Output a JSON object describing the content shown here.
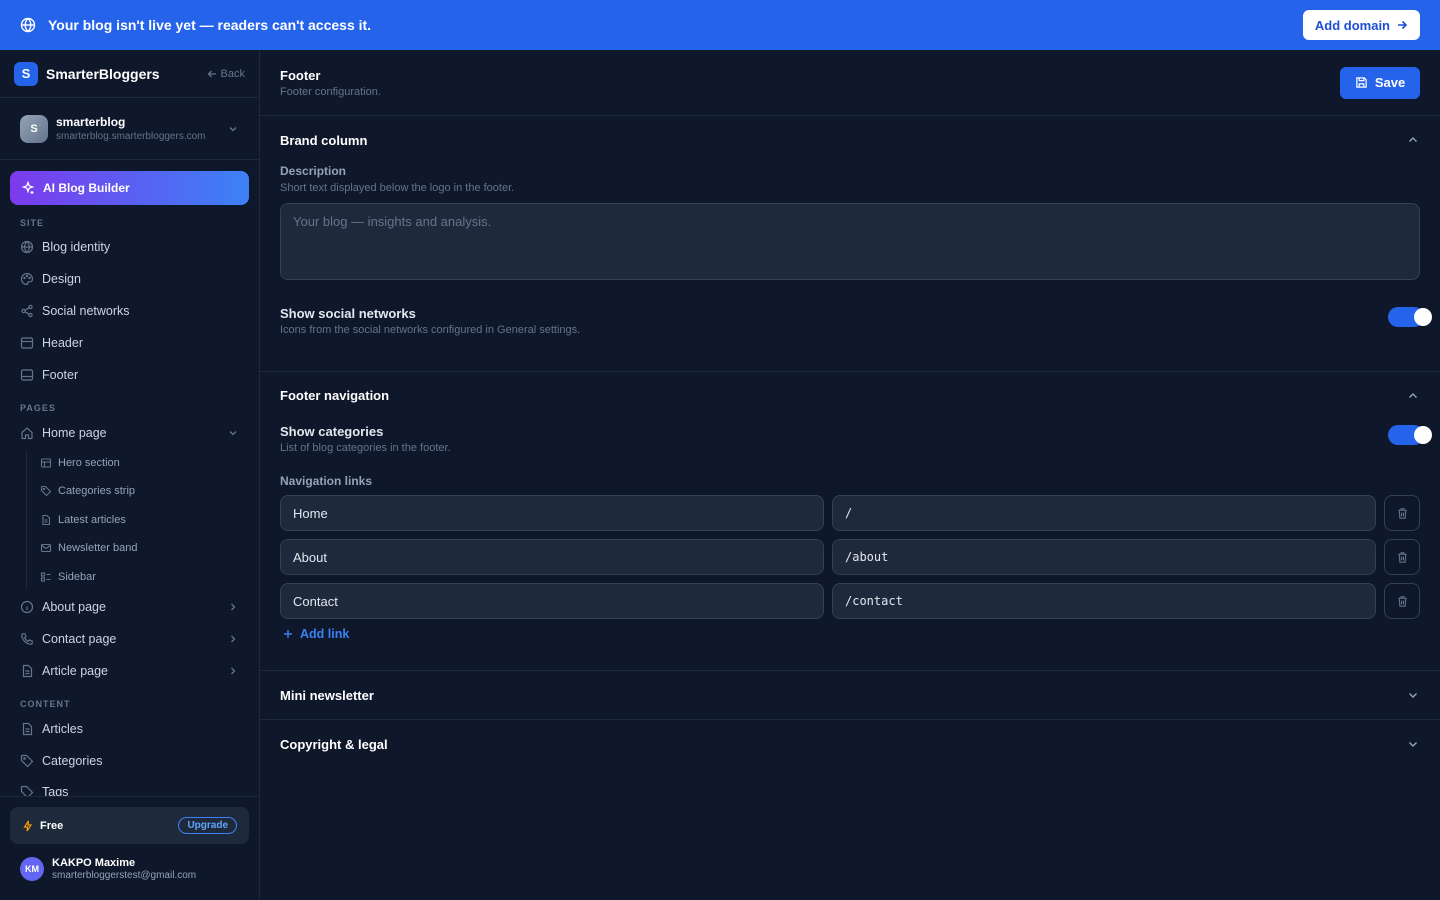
{
  "banner": {
    "message": "Your blog isn't live yet — readers can't access it.",
    "add_domain_label": "Add domain"
  },
  "sidebar": {
    "brand_initial": "S",
    "brand_name": "SmarterBloggers",
    "back_label": "Back",
    "site": {
      "initial": "S",
      "name": "smarterblog",
      "domain": "smarterblog.smarterbloggers.com"
    },
    "ai_builder_label": "AI Blog Builder",
    "sections": {
      "site": "SITE",
      "pages": "PAGES",
      "content": "CONTENT"
    },
    "site_items": [
      {
        "label": "Blog identity",
        "icon": "globe-icon"
      },
      {
        "label": "Design",
        "icon": "palette-icon"
      },
      {
        "label": "Social networks",
        "icon": "share-icon"
      },
      {
        "label": "Header",
        "icon": "layout-icon"
      },
      {
        "label": "Footer",
        "icon": "layout-icon"
      }
    ],
    "pages_items": [
      {
        "label": "Home page",
        "icon": "home-icon",
        "expanded": true
      },
      {
        "label": "About page",
        "icon": "info-icon"
      },
      {
        "label": "Contact page",
        "icon": "phone-icon"
      },
      {
        "label": "Article page",
        "icon": "file-icon"
      }
    ],
    "home_sub_items": [
      {
        "label": "Hero section",
        "icon": "layout-icon"
      },
      {
        "label": "Categories strip",
        "icon": "tag-icon"
      },
      {
        "label": "Latest articles",
        "icon": "file-icon"
      },
      {
        "label": "Newsletter band",
        "icon": "mail-icon"
      },
      {
        "label": "Sidebar",
        "icon": "sidebar-icon"
      }
    ],
    "content_items": [
      {
        "label": "Articles",
        "icon": "file-icon"
      },
      {
        "label": "Categories",
        "icon": "tag-icon"
      },
      {
        "label": "Tags",
        "icon": "tags-icon"
      }
    ],
    "plan": {
      "name": "Free",
      "upgrade_label": "Upgrade"
    },
    "user": {
      "initials": "KM",
      "name": "KAKPO Maxime",
      "email": "smarterbloggerstest@gmail.com"
    }
  },
  "main": {
    "title": "Footer",
    "subtitle": "Footer configuration.",
    "save_label": "Save",
    "brand_column": {
      "title": "Brand column",
      "description_label": "Description",
      "description_help": "Short text displayed below the logo in the footer.",
      "description_placeholder": "Your blog — insights and analysis.",
      "social_label": "Show social networks",
      "social_help": "Icons from the social networks configured in General settings.",
      "social_enabled": true
    },
    "footer_nav": {
      "title": "Footer navigation",
      "categories_label": "Show categories",
      "categories_help": "List of blog categories in the footer.",
      "categories_enabled": true,
      "links_label": "Navigation links",
      "links": [
        {
          "label": "Home",
          "url": "/"
        },
        {
          "label": "About",
          "url": "/about"
        },
        {
          "label": "Contact",
          "url": "/contact"
        }
      ],
      "add_link_label": "Add link"
    },
    "mini_newsletter": {
      "title": "Mini newsletter"
    },
    "copyright": {
      "title": "Copyright & legal"
    }
  },
  "colors": {
    "accent": "#2563eb",
    "background": "#0f172a",
    "surface": "#1e293b",
    "border": "#334155"
  }
}
